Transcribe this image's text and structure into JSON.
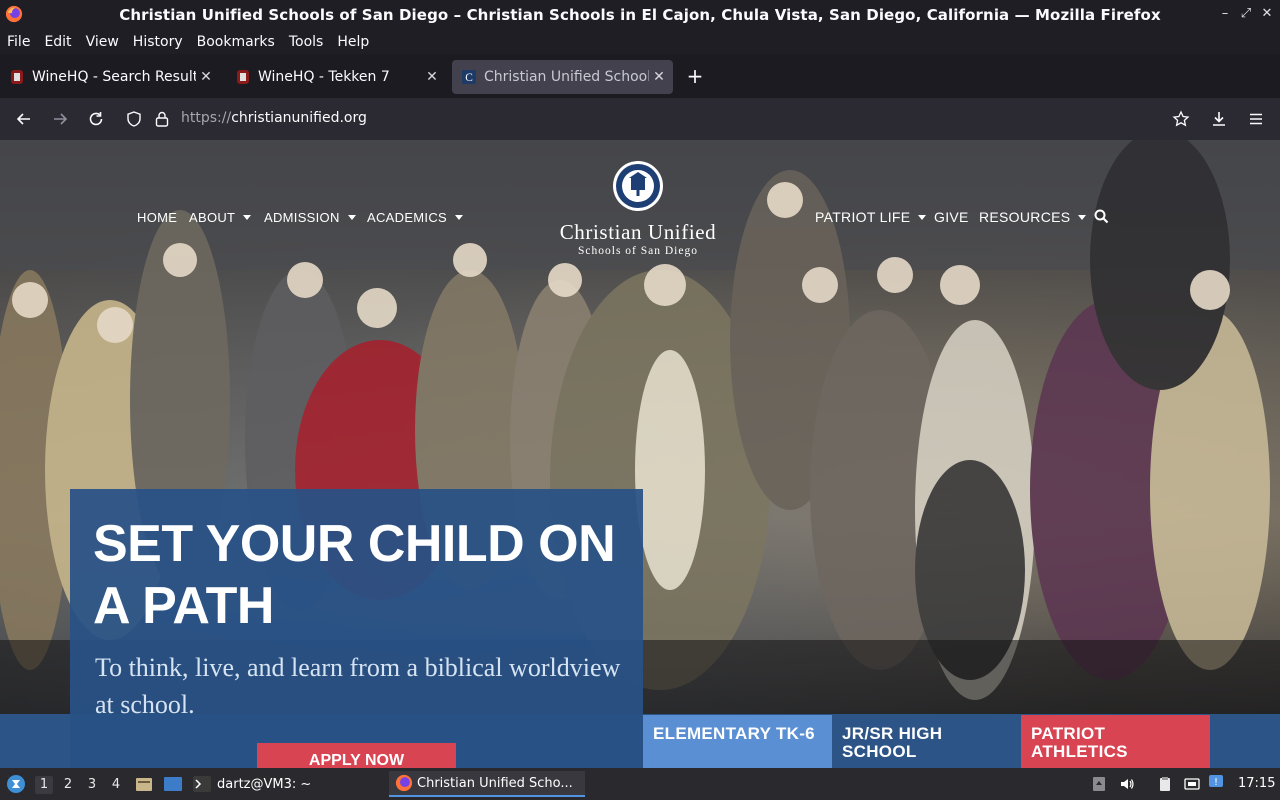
{
  "window": {
    "title": "Christian Unified Schools of San Diego – Christian Schools in El Cajon, Chula Vista, San Diego, California — Mozilla Firefox"
  },
  "menubar": {
    "items": [
      "File",
      "Edit",
      "View",
      "History",
      "Bookmarks",
      "Tools",
      "Help"
    ]
  },
  "tabs": [
    {
      "label": "WineHQ - Search Results",
      "active": false
    },
    {
      "label": "WineHQ - Tekken 7",
      "active": false
    },
    {
      "label": "Christian Unified Schools",
      "active": true
    }
  ],
  "navbar": {
    "url_protocol": "https://",
    "url_domain": "christianunified.org"
  },
  "site": {
    "nav_left": [
      "HOME",
      "ABOUT",
      "ADMISSION",
      "ACADEMICS"
    ],
    "nav_right": [
      "PATRIOT LIFE",
      "GIVE",
      "RESOURCES"
    ],
    "logo_line1": "Christian Unified",
    "logo_line2": "Schools of San Diego",
    "hero_headline": "SET YOUR CHILD ON A PATH",
    "hero_sub": "To think, live, and learn from a biblical worldview at school.",
    "apply_button": "APPLY NOW",
    "tiles": [
      {
        "label": "ELEMENTARY TK-6",
        "color": "#5b8fd4"
      },
      {
        "label": "JR/SR HIGH SCHOOL",
        "color": "#2c5486"
      },
      {
        "label": "PATRIOT ATHLETICS",
        "color": "#d94452"
      }
    ]
  },
  "taskbar": {
    "workspaces": [
      "1",
      "2",
      "3",
      "4"
    ],
    "terminal_task": "dartz@VM3: ~",
    "firefox_task": "Christian Unified Scho...",
    "clock": "17:15"
  }
}
